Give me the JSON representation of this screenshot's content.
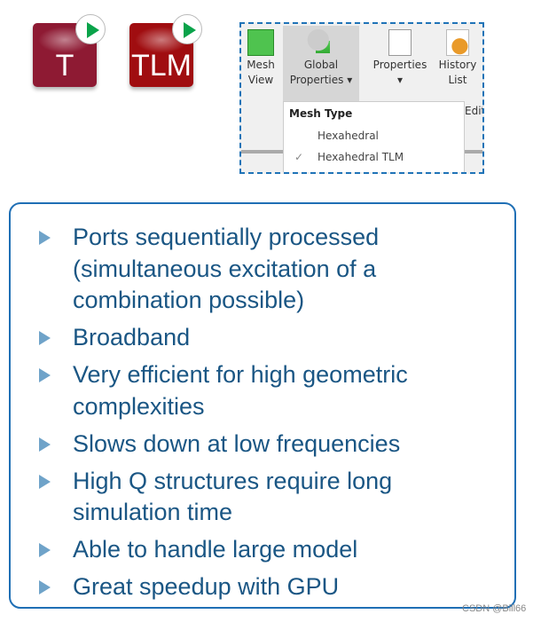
{
  "icons": [
    {
      "label": "T",
      "color": "#8e1a33"
    },
    {
      "label": "TLM",
      "color": "#a00d10"
    }
  ],
  "ribbon": {
    "buttons": [
      {
        "label1": "Mesh",
        "label2": "View"
      },
      {
        "label1": "Global",
        "label2": "Properties ▾"
      },
      {
        "label1": "Properties",
        "label2": "▾"
      },
      {
        "label1": "History",
        "label2": "List"
      }
    ],
    "group_label": "Edit",
    "menu": {
      "header": "Mesh Type",
      "items": [
        {
          "label": "Hexahedral",
          "checked": false
        },
        {
          "label": "Hexahedral TLM",
          "checked": true
        }
      ],
      "check": "✓"
    }
  },
  "bullets": [
    "Ports sequentially processed (simultaneous excitation of a combination possible)",
    "Broadband",
    "Very efficient for high geometric complexities",
    "Slows down at low frequencies",
    "High Q structures require long simulation time",
    "Able to handle large model",
    "Great speedup with GPU"
  ],
  "watermark": "CSDN @Bill66"
}
